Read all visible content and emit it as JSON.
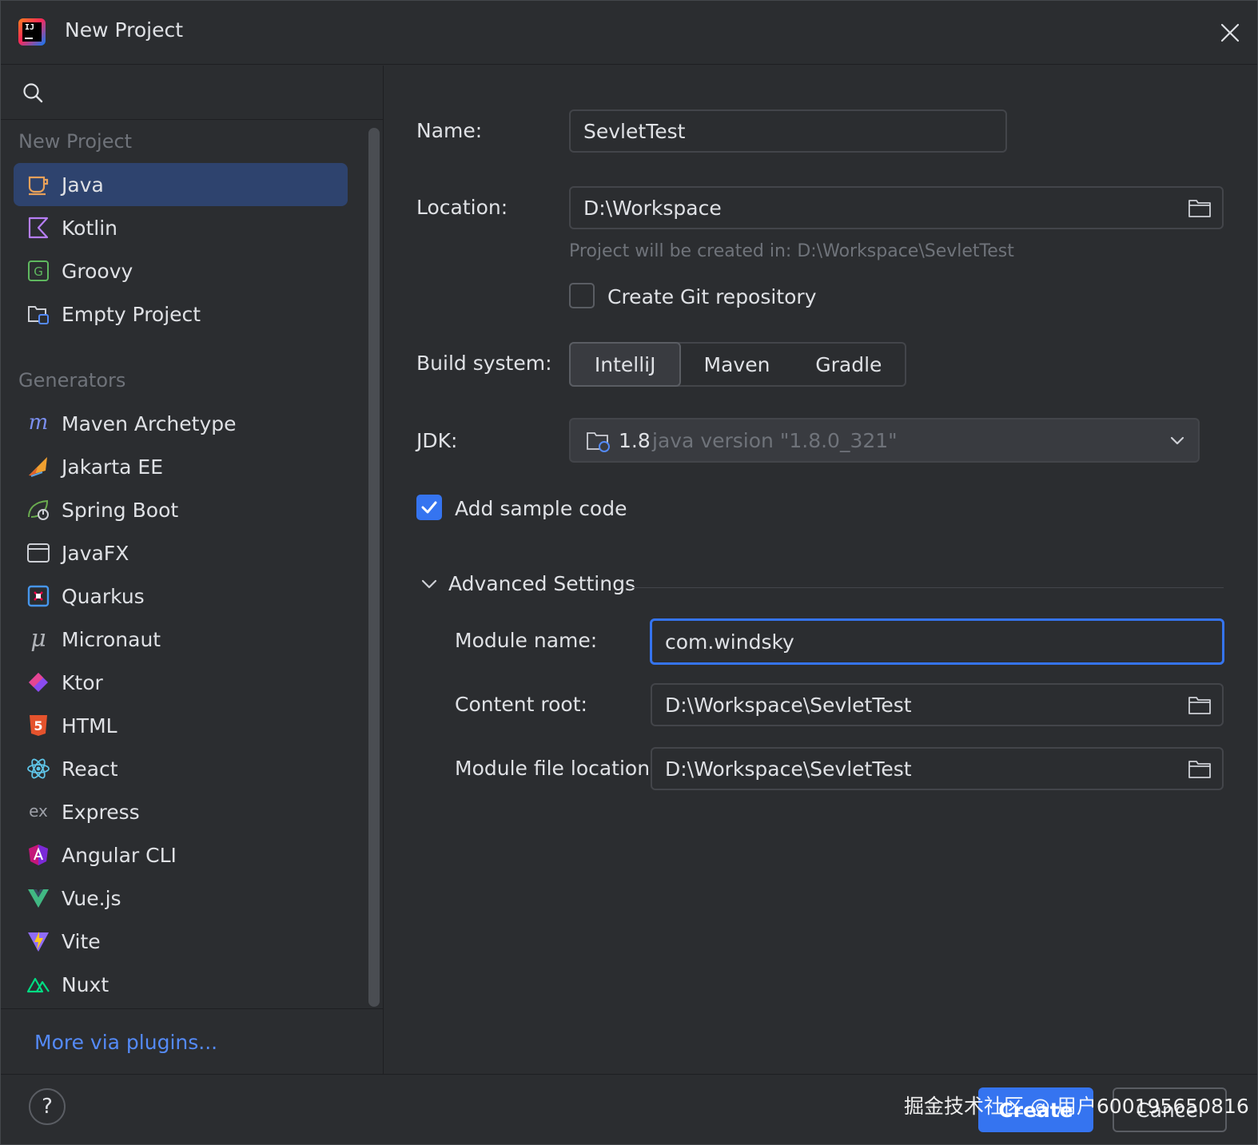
{
  "window": {
    "title": "New Project"
  },
  "sidebar": {
    "search_icon": "search-icon",
    "new_project_group": "New Project",
    "new_project_items": [
      {
        "label": "Java",
        "icon": "java-icon",
        "selected": true
      },
      {
        "label": "Kotlin",
        "icon": "kotlin-icon"
      },
      {
        "label": "Groovy",
        "icon": "groovy-icon"
      },
      {
        "label": "Empty Project",
        "icon": "empty-project-icon"
      }
    ],
    "generators_group": "Generators",
    "generator_items": [
      {
        "label": "Maven Archetype",
        "icon": "maven-icon"
      },
      {
        "label": "Jakarta EE",
        "icon": "jakarta-icon"
      },
      {
        "label": "Spring Boot",
        "icon": "spring-icon"
      },
      {
        "label": "JavaFX",
        "icon": "javafx-icon"
      },
      {
        "label": "Quarkus",
        "icon": "quarkus-icon"
      },
      {
        "label": "Micronaut",
        "icon": "micronaut-icon"
      },
      {
        "label": "Ktor",
        "icon": "ktor-icon"
      },
      {
        "label": "HTML",
        "icon": "html-icon"
      },
      {
        "label": "React",
        "icon": "react-icon"
      },
      {
        "label": "Express",
        "icon": "express-icon"
      },
      {
        "label": "Angular CLI",
        "icon": "angular-icon"
      },
      {
        "label": "Vue.js",
        "icon": "vue-icon"
      },
      {
        "label": "Vite",
        "icon": "vite-icon"
      },
      {
        "label": "Nuxt",
        "icon": "nuxt-icon"
      }
    ],
    "more_link": "More via plugins..."
  },
  "form": {
    "name_label": "Name:",
    "name_value": "SevletTest",
    "location_label": "Location:",
    "location_value": "D:\\Workspace",
    "location_hint": "Project will be created in: D:\\Workspace\\SevletTest",
    "git_label": "Create Git repository",
    "git_checked": false,
    "build_label": "Build system:",
    "build_options": [
      "IntelliJ",
      "Maven",
      "Gradle"
    ],
    "build_selected": "IntelliJ",
    "jdk_label": "JDK:",
    "jdk_version": "1.8",
    "jdk_description": "java version \"1.8.0_321\"",
    "sample_label": "Add sample code",
    "sample_checked": true
  },
  "advanced": {
    "title": "Advanced Settings",
    "expanded": true,
    "module_name_label": "Module name:",
    "module_name_value": "com.windsky",
    "content_root_label": "Content root:",
    "content_root_value": "D:\\Workspace\\SevletTest",
    "module_file_label": "Module file location:",
    "module_file_value": "D:\\Workspace\\SevletTest"
  },
  "footer": {
    "help": "?",
    "create": "Create",
    "cancel": "Cancel",
    "watermark": "掘金技术社区 @ 用户600195650816"
  },
  "colors": {
    "background": "#2b2d30",
    "accent": "#3574f0",
    "selection": "#2e436e",
    "link": "#548af7",
    "muted_text": "#6f737a"
  }
}
